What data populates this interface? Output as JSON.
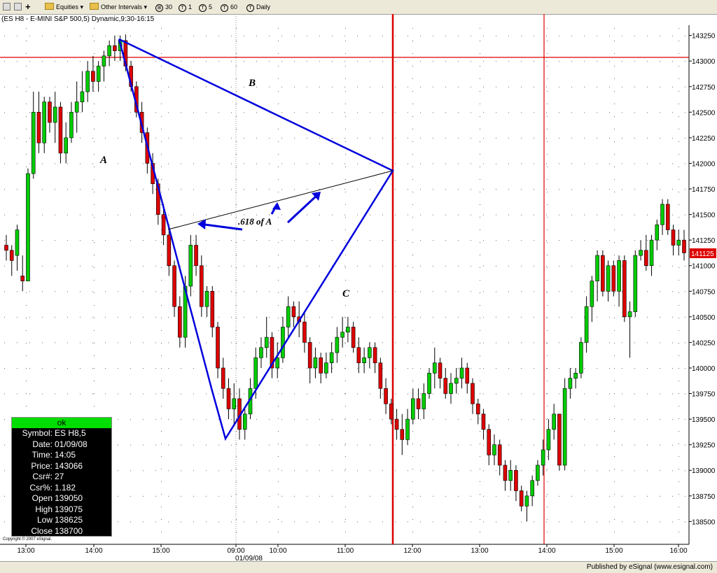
{
  "toolbar": {
    "equities": "Equities",
    "other_intervals": "Other Intervals",
    "intervals": [
      {
        "icon": "⊞",
        "label": "30"
      },
      {
        "icon": "T",
        "label": "1"
      },
      {
        "icon": "T",
        "label": "5"
      },
      {
        "icon": "T",
        "label": "60"
      },
      {
        "icon": "T",
        "label": "Daily"
      }
    ]
  },
  "chart_title": "(ES H8 - E-MINI S&P 500,5) Dynamic,9:30-16:15",
  "price_axis": {
    "ticks": [
      "143250",
      "143000",
      "142750",
      "142500",
      "142250",
      "142000",
      "141750",
      "141500",
      "141250",
      "141000",
      "140750",
      "140500",
      "140250",
      "140000",
      "139750",
      "139500",
      "139250",
      "139000",
      "138750",
      "138500"
    ],
    "current_price": "141125"
  },
  "time_axis": {
    "ticks": [
      "13:00",
      "14:00",
      "15:00",
      "09:00",
      "10:00",
      "11:00",
      "12:00",
      "13:00",
      "14:00",
      "15:00",
      "16:00"
    ],
    "date_label": "01/09/08"
  },
  "annotations": {
    "A": "A",
    "B": "B",
    "C": "C",
    "fib": ".618 of A"
  },
  "databox": {
    "status": "ok",
    "rows": [
      {
        "label": "Symbol:",
        "value": "ES H8,5"
      },
      {
        "label": "Date:",
        "value": "01/09/08"
      },
      {
        "label": "Time:",
        "value": "14:05"
      },
      {
        "label": "Price:",
        "value": "143066"
      },
      {
        "label": "Csr#:",
        "value": "27"
      },
      {
        "label": "Csr%:",
        "value": "1.182"
      },
      {
        "label": "Open",
        "value": "139050"
      },
      {
        "label": "High",
        "value": "139075"
      },
      {
        "label": "Low",
        "value": "138625"
      },
      {
        "label": "Close",
        "value": "138700"
      }
    ]
  },
  "copyright": "Copyright © 2007 eSignal.",
  "status_bar": "Published by eSignal (www.esignal.com)",
  "colors": {
    "up": "#00cc00",
    "down": "#dd0000",
    "line": "#0000dd",
    "cursor": "#dd0000"
  },
  "chart_data": {
    "type": "candlestick",
    "y_range": [
      138400,
      143350
    ],
    "candles": [
      [
        141200,
        141300,
        141050,
        141150
      ],
      [
        141150,
        141200,
        140900,
        141050
      ],
      [
        141100,
        141400,
        140950,
        141350
      ],
      [
        140900,
        141100,
        140750,
        140850
      ],
      [
        140850,
        141950,
        140850,
        141900
      ],
      [
        141900,
        142700,
        141850,
        142500
      ],
      [
        142500,
        142700,
        142100,
        142200
      ],
      [
        142200,
        142650,
        142100,
        142600
      ],
      [
        142600,
        142650,
        142300,
        142400
      ],
      [
        142400,
        142700,
        142200,
        142550
      ],
      [
        142550,
        142600,
        142000,
        142100
      ],
      [
        142100,
        142400,
        142000,
        142250
      ],
      [
        142250,
        142600,
        142200,
        142500
      ],
      [
        142500,
        142800,
        142300,
        142600
      ],
      [
        142600,
        142900,
        142500,
        142700
      ],
      [
        142700,
        143000,
        142600,
        142900
      ],
      [
        142900,
        143050,
        142700,
        142800
      ],
      [
        142800,
        143000,
        142700,
        142950
      ],
      [
        142950,
        143100,
        142800,
        143050
      ],
      [
        143050,
        143200,
        142950,
        143150
      ],
      [
        143150,
        143250,
        143000,
        143100
      ],
      [
        143100,
        143250,
        143000,
        143200
      ],
      [
        143200,
        143260,
        142900,
        142950
      ],
      [
        142950,
        143000,
        142700,
        142750
      ],
      [
        142750,
        142800,
        142450,
        142500
      ],
      [
        142500,
        142600,
        142200,
        142300
      ],
      [
        142300,
        142350,
        141900,
        142000
      ],
      [
        142000,
        142100,
        141700,
        141800
      ],
      [
        141800,
        141850,
        141400,
        141500
      ],
      [
        141500,
        141600,
        141200,
        141300
      ],
      [
        141300,
        141400,
        140900,
        141000
      ],
      [
        141000,
        141050,
        140500,
        140600
      ],
      [
        140600,
        140700,
        140200,
        140300
      ],
      [
        140300,
        140900,
        140200,
        140800
      ],
      [
        140800,
        141300,
        140700,
        141200
      ],
      [
        141200,
        141300,
        140900,
        141000
      ],
      [
        141000,
        141100,
        140500,
        140600
      ],
      [
        140600,
        140800,
        140500,
        140750
      ],
      [
        140750,
        140800,
        140300,
        140400
      ],
      [
        140400,
        140450,
        139900,
        140000
      ],
      [
        140000,
        140100,
        139700,
        139800
      ],
      [
        139800,
        139900,
        139500,
        139600
      ],
      [
        139600,
        139850,
        139450,
        139700
      ],
      [
        139700,
        139800,
        139300,
        139400
      ],
      [
        139400,
        139600,
        139300,
        139550
      ],
      [
        139550,
        139900,
        139500,
        139800
      ],
      [
        139800,
        140200,
        139700,
        140100
      ],
      [
        140100,
        140300,
        140000,
        140200
      ],
      [
        140200,
        140500,
        140100,
        140300
      ],
      [
        140300,
        140350,
        139900,
        140000
      ],
      [
        140000,
        140250,
        139900,
        140100
      ],
      [
        140100,
        140500,
        140050,
        140400
      ],
      [
        140400,
        140700,
        140300,
        140600
      ],
      [
        140600,
        140650,
        140400,
        140500
      ],
      [
        140500,
        140650,
        140300,
        140450
      ],
      [
        140450,
        140550,
        140150,
        140250
      ],
      [
        140250,
        140300,
        139850,
        140000
      ],
      [
        140000,
        140200,
        139900,
        140100
      ],
      [
        140100,
        140150,
        139850,
        139950
      ],
      [
        139950,
        140150,
        139900,
        140050
      ],
      [
        140050,
        140250,
        139950,
        140150
      ],
      [
        140150,
        140400,
        140050,
        140300
      ],
      [
        140300,
        140500,
        140200,
        140350
      ],
      [
        140350,
        140500,
        140250,
        140400
      ],
      [
        140400,
        140450,
        140150,
        140200
      ],
      [
        140200,
        140300,
        139950,
        140050
      ],
      [
        140050,
        140200,
        139950,
        140100
      ],
      [
        140100,
        140250,
        140000,
        140200
      ],
      [
        140200,
        140250,
        139950,
        140050
      ],
      [
        140050,
        140100,
        139700,
        139800
      ],
      [
        139800,
        139900,
        139550,
        139650
      ],
      [
        139650,
        139700,
        139450,
        139500
      ],
      [
        139500,
        139600,
        139300,
        139400
      ],
      [
        139400,
        139550,
        139150,
        139300
      ],
      [
        139300,
        139600,
        139250,
        139500
      ],
      [
        139500,
        139800,
        139450,
        139700
      ],
      [
        139700,
        139800,
        139500,
        139600
      ],
      [
        139600,
        139850,
        139500,
        139750
      ],
      [
        139750,
        140000,
        139700,
        139950
      ],
      [
        139950,
        140200,
        139800,
        140050
      ],
      [
        140050,
        140100,
        139800,
        139900
      ],
      [
        139900,
        140000,
        139700,
        139750
      ],
      [
        139750,
        139950,
        139650,
        139850
      ],
      [
        139850,
        140000,
        139750,
        139900
      ],
      [
        139900,
        140100,
        139800,
        140000
      ],
      [
        140000,
        140050,
        139750,
        139850
      ],
      [
        139850,
        139900,
        139550,
        139650
      ],
      [
        139650,
        139700,
        139450,
        139550
      ],
      [
        139550,
        139600,
        139300,
        139400
      ],
      [
        139400,
        139450,
        139050,
        139150
      ],
      [
        139150,
        139350,
        139050,
        139250
      ],
      [
        139250,
        139300,
        138950,
        139050
      ],
      [
        139050,
        139100,
        138800,
        138900
      ],
      [
        138900,
        139100,
        138800,
        139000
      ],
      [
        139000,
        139050,
        138700,
        138800
      ],
      [
        138800,
        138850,
        138600,
        138650
      ],
      [
        138650,
        138800,
        138500,
        138750
      ],
      [
        138750,
        138950,
        138650,
        138900
      ],
      [
        138900,
        139100,
        138850,
        139050
      ],
      [
        139050,
        139300,
        138950,
        139200
      ],
      [
        139200,
        139500,
        139100,
        139400
      ],
      [
        139400,
        139650,
        139300,
        139550
      ],
      [
        139550,
        139550,
        139000,
        139050
      ],
      [
        139050,
        139900,
        139000,
        139800
      ],
      [
        139800,
        140000,
        139700,
        139900
      ],
      [
        139900,
        140000,
        139800,
        139950
      ],
      [
        139950,
        140300,
        139900,
        140250
      ],
      [
        140250,
        140700,
        140150,
        140600
      ],
      [
        140600,
        140900,
        140450,
        140850
      ],
      [
        140850,
        141150,
        140650,
        141100
      ],
      [
        141100,
        141150,
        140700,
        140750
      ],
      [
        140750,
        141050,
        140650,
        141000
      ],
      [
        141000,
        141050,
        140700,
        140750
      ],
      [
        140750,
        141100,
        140600,
        141050
      ],
      [
        141050,
        141100,
        140450,
        140500
      ],
      [
        140500,
        140650,
        140100,
        140550
      ],
      [
        140550,
        141150,
        140500,
        141100
      ],
      [
        141100,
        141250,
        141050,
        141150
      ],
      [
        141150,
        141300,
        140950,
        141000
      ],
      [
        141000,
        141300,
        140900,
        141250
      ],
      [
        141250,
        141450,
        141150,
        141400
      ],
      [
        141400,
        141650,
        141300,
        141600
      ],
      [
        141600,
        141650,
        141300,
        141350
      ],
      [
        141350,
        141400,
        141100,
        141200
      ],
      [
        141200,
        141350,
        141100,
        141250
      ],
      [
        141250,
        141350,
        141050,
        141125
      ]
    ]
  }
}
